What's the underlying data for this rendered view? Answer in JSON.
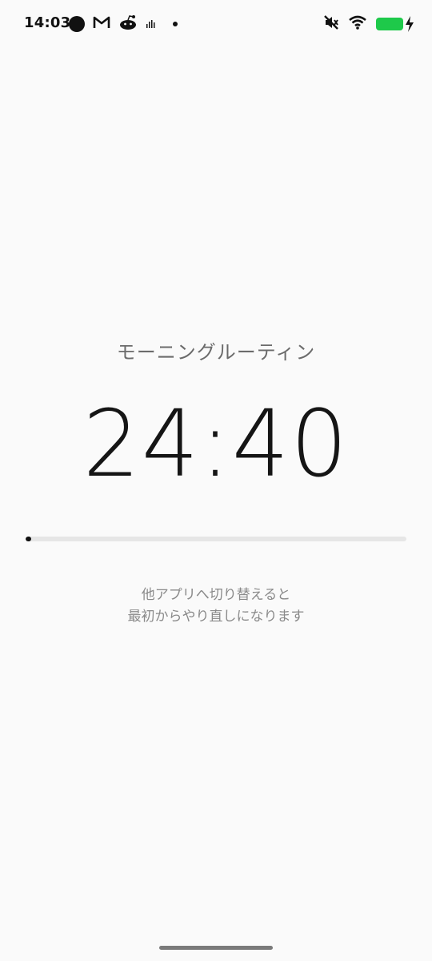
{
  "status_bar": {
    "time": "14:03",
    "notification_icons": [
      "circle-icon",
      "gmail-icon",
      "reddit-icon",
      "signal-bars-icon",
      "dot-icon"
    ],
    "system_icons": [
      "mute-icon",
      "wifi-icon",
      "battery-charging-icon"
    ],
    "battery_color": "#1ec94a"
  },
  "main": {
    "title": "モーニングルーティン",
    "timer": "24:40",
    "progress_fraction": 0.015,
    "notice_line1": "他アプリへ切り替えると",
    "notice_line2": "最初からやり直しになります"
  }
}
